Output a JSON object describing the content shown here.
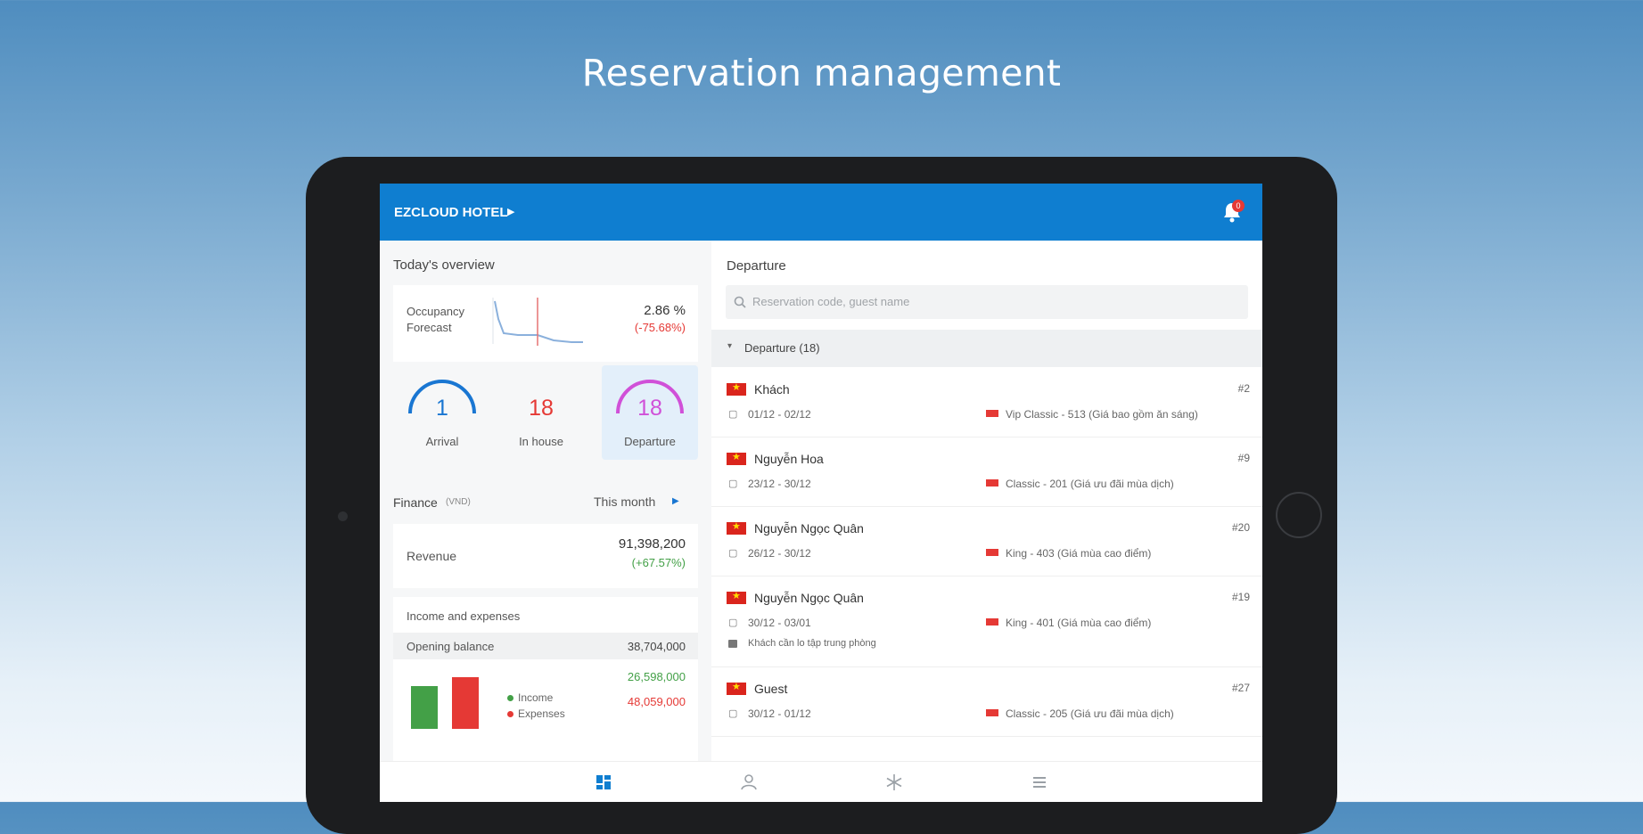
{
  "headline": "Reservation management",
  "app": {
    "hotel_name": "EZCLOUD HOTEL",
    "notification_count": "0"
  },
  "overview": {
    "title": "Today's overview",
    "occupancy_label_1": "Occupancy",
    "occupancy_label_2": "Forecast",
    "occupancy_value": "2.86 %",
    "occupancy_change": "(-75.68%)",
    "arrival_count": "1",
    "arrival_label": "Arrival",
    "inhouse_count": "18",
    "inhouse_label": "In house",
    "departure_count": "18",
    "departure_label": "Departure"
  },
  "finance": {
    "title": "Finance",
    "currency": "(VND)",
    "period": "This month",
    "revenue_label": "Revenue",
    "revenue_value": "91,398,200",
    "revenue_change": "(+67.57%)",
    "ie_title": "Income and expenses",
    "opening_label": "Opening balance",
    "opening_value": "38,704,000",
    "income_label": "Income",
    "income_value": "26,598,000",
    "expenses_label": "Expenses",
    "expenses_value": "48,059,000",
    "income_color": "#43a047",
    "expenses_color": "#e53935"
  },
  "departure": {
    "title": "Departure",
    "search_placeholder": "Reservation code, guest name",
    "group_label": "Departure (18)",
    "items": [
      {
        "name": "Khách",
        "dates": "01/12 - 02/12",
        "room": "Vip Classic - 513 (Giá bao gồm ăn sáng)",
        "code": "#2",
        "note": ""
      },
      {
        "name": "Nguyễn Hoa",
        "dates": "23/12 - 30/12",
        "room": "Classic - 201 (Giá ưu đãi mùa dịch)",
        "code": "#9",
        "note": ""
      },
      {
        "name": "Nguyễn Ngọc Quân",
        "dates": "26/12 - 30/12",
        "room": "King - 403 (Giá mùa cao điểm)",
        "code": "#20",
        "note": ""
      },
      {
        "name": "Nguyễn Ngọc Quân",
        "dates": "30/12 - 03/01",
        "room": "King - 401 (Giá mùa cao điểm)",
        "code": "#19",
        "note": "Khách cần lo tập trung phòng"
      },
      {
        "name": "Guest",
        "dates": "30/12 - 01/12",
        "room": "Classic - 205 (Giá ưu đãi mùa dịch)",
        "code": "#27",
        "note": ""
      }
    ]
  },
  "nav": {
    "active_color": "#0f7ed0",
    "items": [
      "dashboard-icon",
      "person-icon",
      "snowflake-icon",
      "menu-icon"
    ]
  }
}
